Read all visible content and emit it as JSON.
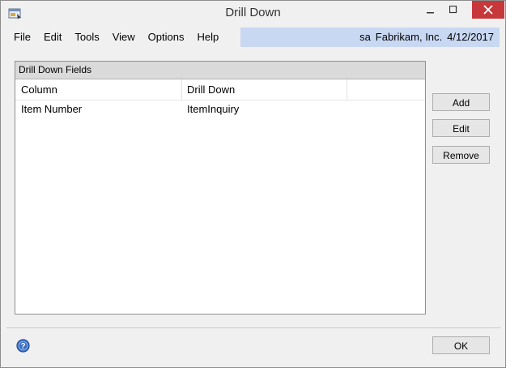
{
  "window": {
    "title": "Drill Down"
  },
  "menu": {
    "items": [
      "File",
      "Edit",
      "Tools",
      "View",
      "Options",
      "Help"
    ]
  },
  "status": {
    "user": "sa",
    "company": "Fabrikam, Inc.",
    "date": "4/12/2017"
  },
  "group": {
    "title": "Drill Down Fields",
    "columns": [
      "Column",
      "Drill Down"
    ],
    "rows": [
      {
        "column": "Item Number",
        "drill_down": "ItemInquiry"
      }
    ]
  },
  "buttons": {
    "add": "Add",
    "edit": "Edit",
    "remove": "Remove",
    "ok": "OK"
  },
  "icons": {
    "app": "drill-down-app-icon",
    "help": "help-icon",
    "close": "close-icon"
  },
  "colors": {
    "close_button": "#c7383b",
    "menubar_accent": "#c9d8f2",
    "header": "#dadada"
  }
}
